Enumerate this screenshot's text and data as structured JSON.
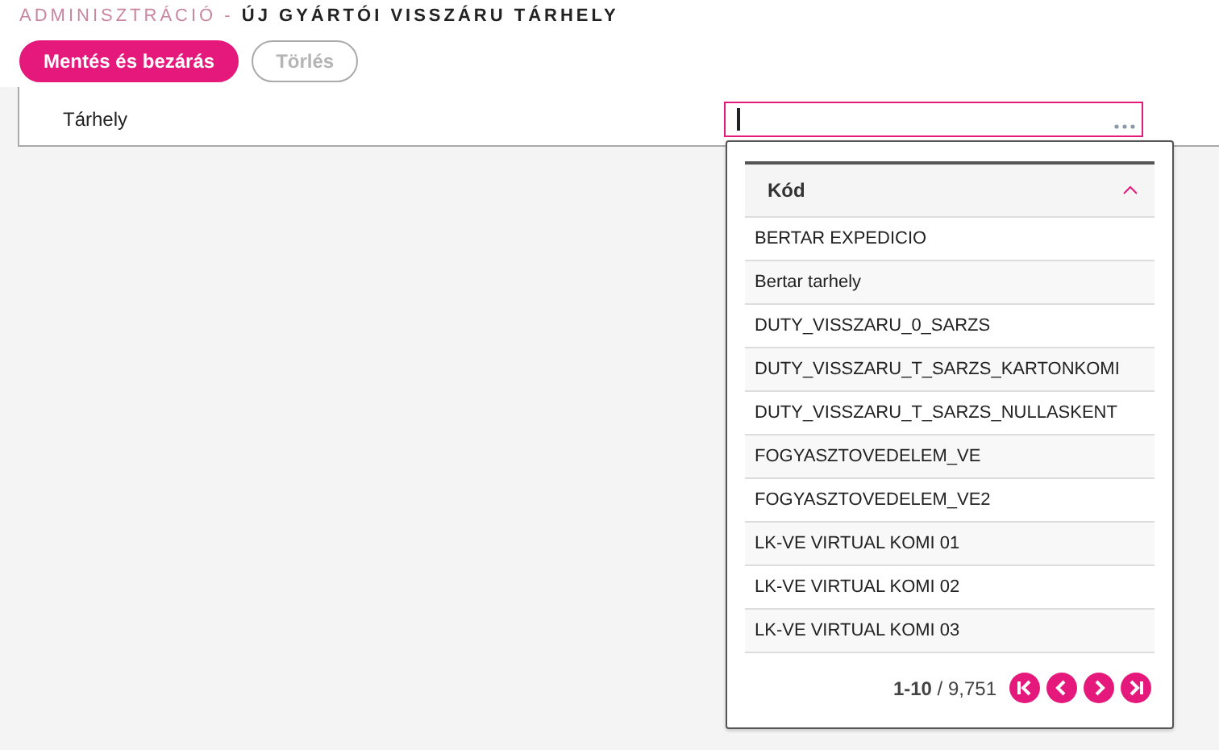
{
  "breadcrumb": {
    "parent": "ADMINISZTRÁCIÓ -",
    "title": "ÚJ GYÁRTÓI VISSZÁRU TÁRHELY"
  },
  "buttons": [
    {
      "label": "Mentés és bezárás",
      "kind": "primary",
      "disabled": false
    },
    {
      "label": "Törlés",
      "kind": "outline",
      "disabled": true
    }
  ],
  "field": {
    "label": "Tárhely",
    "focused": true
  },
  "dropdown": {
    "column": "Kód",
    "rows": [
      "BERTAR EXPEDICIO",
      "Bertar tarhely",
      "DUTY_VISSZARU_0_SARZS",
      "DUTY_VISSZARU_T_SARZS_KARTONKOMI",
      "DUTY_VISSZARU_T_SARZS_NULLASKENT",
      "FOGYASZTOVEDELEM_VE",
      "FOGYASZTOVEDELEM_VE2",
      "LK-VE VIRTUAL KOMI 01",
      "LK-VE VIRTUAL KOMI 02",
      "LK-VE VIRTUAL KOMI 03"
    ],
    "range": "**1-10** / 9,751"
  }
}
